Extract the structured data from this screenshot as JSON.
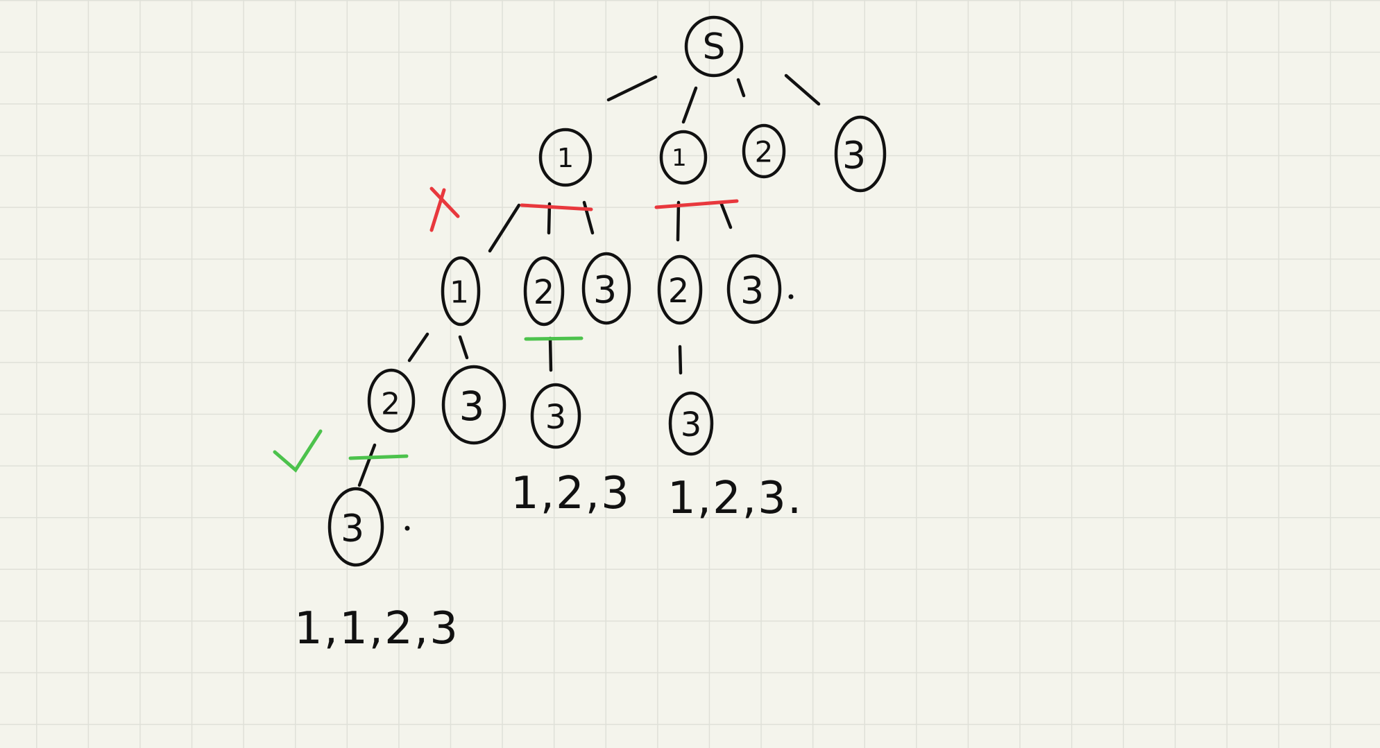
{
  "colors": {
    "ink": "#111111",
    "prune_red": "#e8383d",
    "keep_green": "#4cc24c",
    "paper": "#f4f4ec",
    "grid": "#dfe0d8"
  },
  "nodes": [
    {
      "id": "root",
      "label": "S"
    },
    {
      "id": "a1",
      "label": "1"
    },
    {
      "id": "b1",
      "label": "1"
    },
    {
      "id": "b2",
      "label": "2"
    },
    {
      "id": "b3",
      "label": "3"
    },
    {
      "id": "a1_1",
      "label": "1"
    },
    {
      "id": "a1_2",
      "label": "2"
    },
    {
      "id": "a1_3",
      "label": "3"
    },
    {
      "id": "b1_2",
      "label": "2"
    },
    {
      "id": "b1_3",
      "label": "3"
    },
    {
      "id": "a1_1_2",
      "label": "2"
    },
    {
      "id": "a1_1_3",
      "label": "3"
    },
    {
      "id": "a1_2_3",
      "label": "3"
    },
    {
      "id": "b1_2_3",
      "label": "3"
    },
    {
      "id": "a1_1_2_3",
      "label": "3"
    }
  ],
  "markers": {
    "cross": "icon-cross",
    "check": "icon-check"
  },
  "results": [
    {
      "id": "res-1",
      "text": "1,1,2,3"
    },
    {
      "id": "res-2",
      "text": "1,2,3"
    },
    {
      "id": "res-3",
      "text": "1,2,3."
    }
  ]
}
